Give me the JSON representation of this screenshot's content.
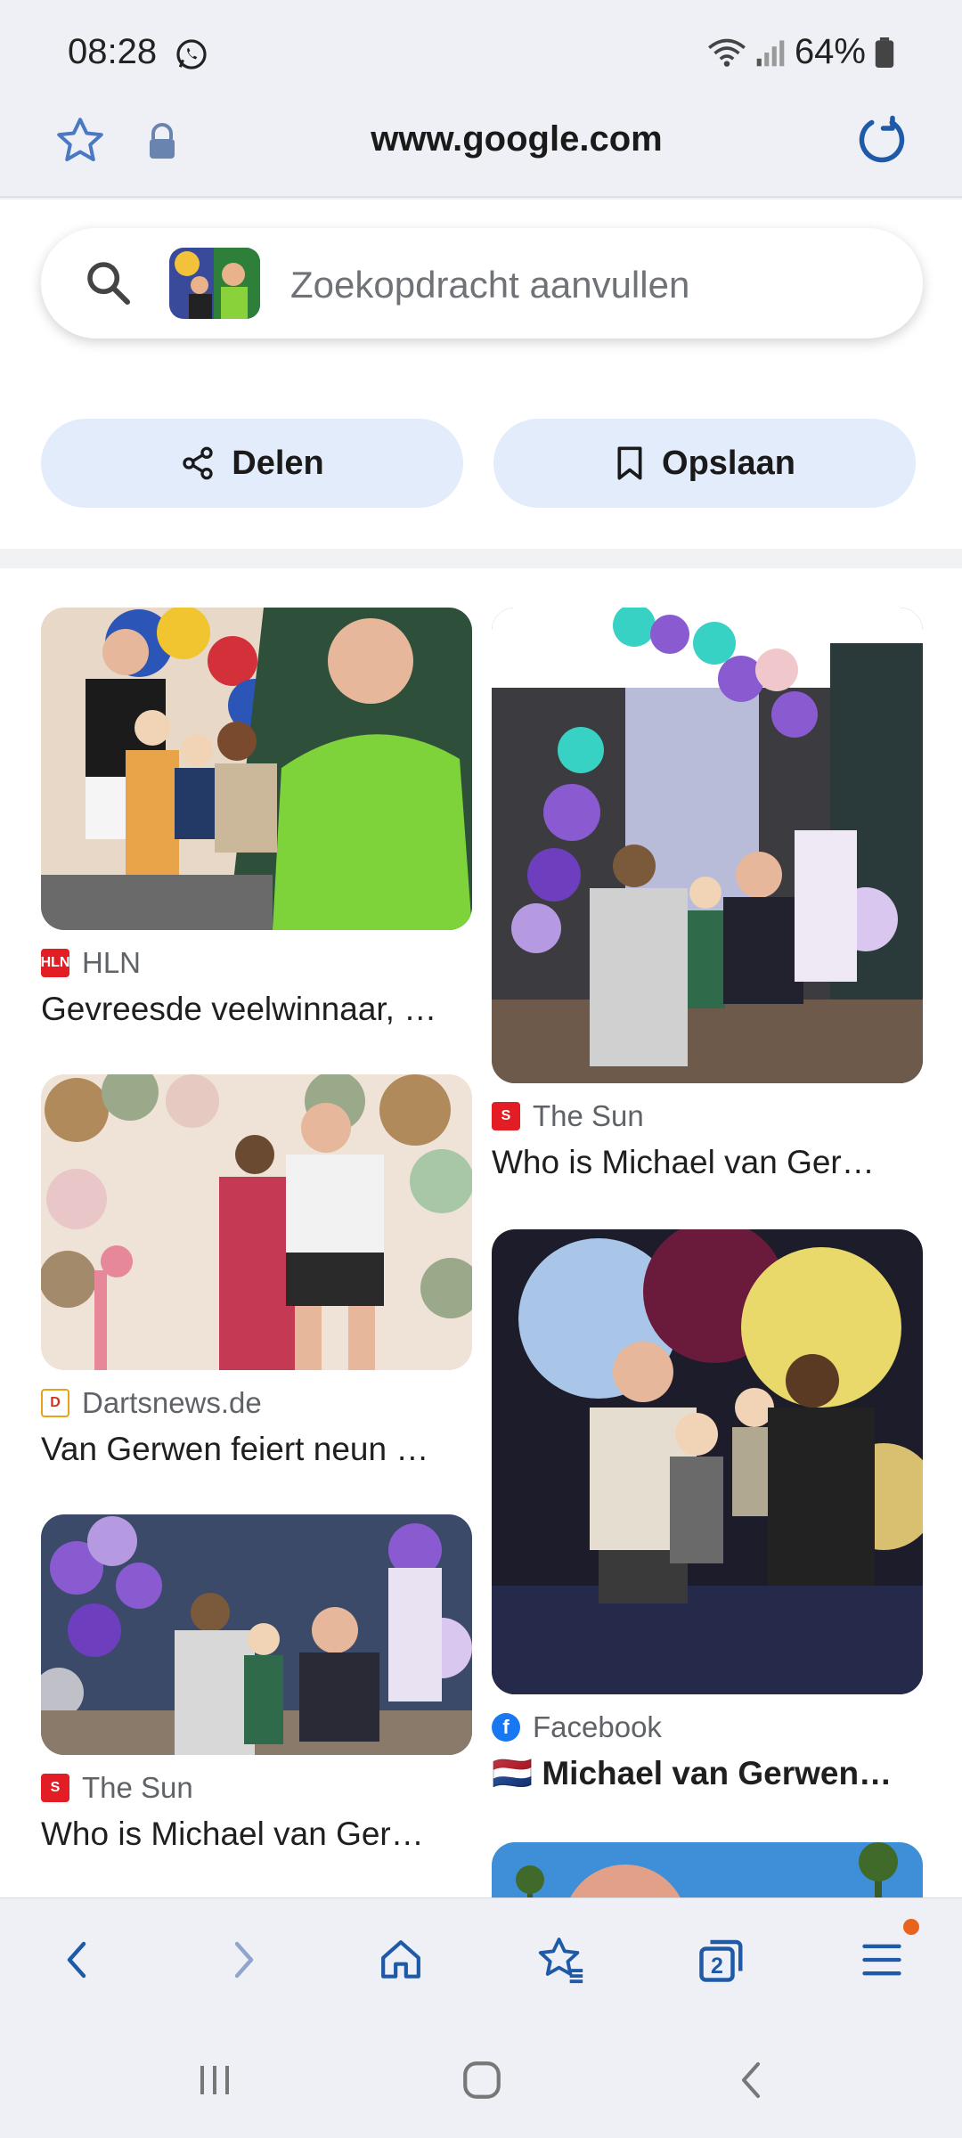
{
  "status": {
    "time": "08:28",
    "battery": "64%"
  },
  "url_bar": {
    "url": "www.google.com"
  },
  "search": {
    "placeholder": "Zoekopdracht aanvullen"
  },
  "actions": {
    "share_label": "Delen",
    "save_label": "Opslaan"
  },
  "results": [
    {
      "source": "HLN",
      "title": "Gevreesde veelwinnaar, …"
    },
    {
      "source": "The Sun",
      "title": "Who is Michael van Ger…"
    },
    {
      "source": "Dartsnews.de",
      "title": "Van Gerwen feiert neun …"
    },
    {
      "source": "Facebook",
      "title": "🇳🇱 Michael van Gerwen…"
    },
    {
      "source": "The Sun",
      "title": "Who is Michael van Ger…"
    }
  ],
  "bottom_nav": {
    "tab_count": "2"
  },
  "colors": {
    "accent": "#1f5aa8",
    "sheet": "#ffffff",
    "chrome": "#eef0f5",
    "pill": "#e3ecfb",
    "notify": "#e8641c"
  }
}
